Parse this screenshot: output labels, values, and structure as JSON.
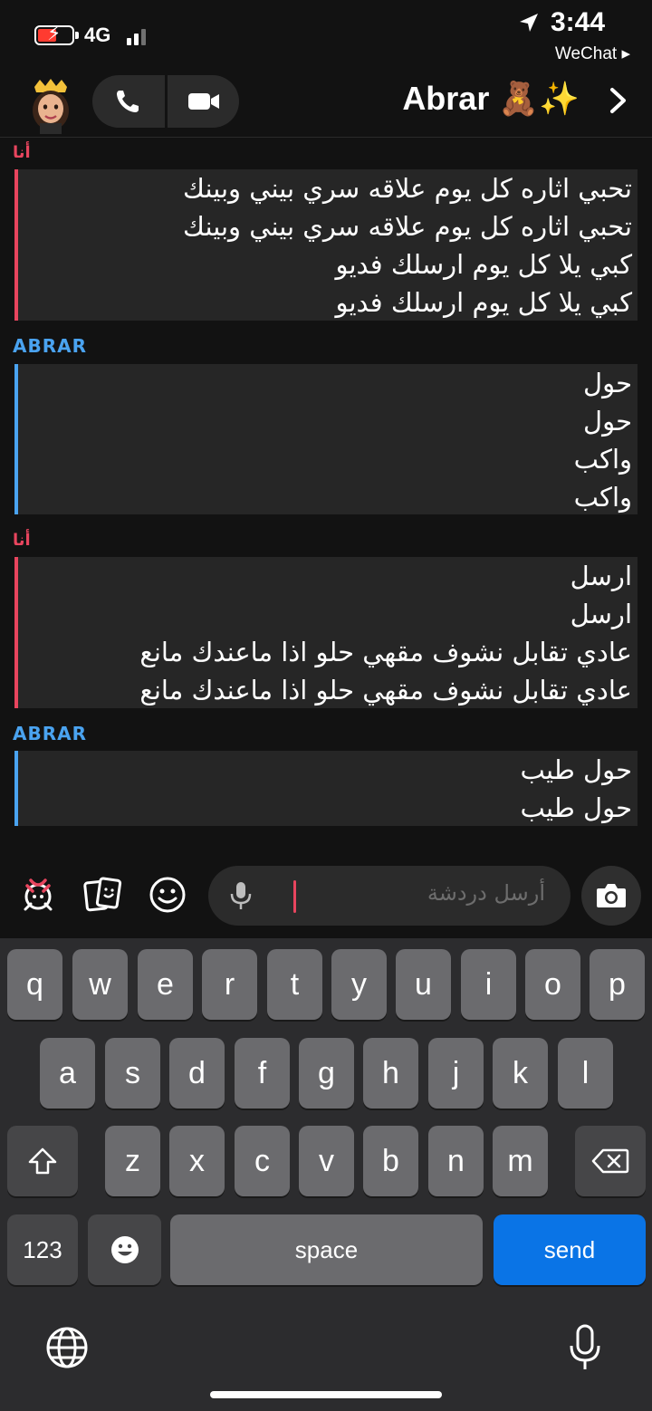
{
  "status_bar": {
    "network": "4G",
    "time": "3:44",
    "back_app": "WeChat ▸"
  },
  "header": {
    "contact_name": "Abrar 🧸✨"
  },
  "messages": [
    {
      "sender": "أنا",
      "from_me": true,
      "lines": [
        "تحبي اثاره كل يوم علاقه سري بيني وبينك",
        "تحبي اثاره كل يوم علاقه سري بيني وبينك",
        "كبي يلا كل يوم ارسلك فديو",
        "كبي يلا كل يوم ارسلك فديو"
      ]
    },
    {
      "sender": "ABRAR",
      "from_me": false,
      "lines": [
        "حول",
        "حول",
        "واكب",
        "واكب"
      ]
    },
    {
      "sender": "أنا",
      "from_me": true,
      "lines": [
        "ارسل",
        "ارسل",
        "عادي تقابل نشوف مقهي حلو اذا ماعندك مانع",
        "عادي تقابل نشوف مقهي حلو اذا ماعندك مانع"
      ]
    },
    {
      "sender": "ABRAR",
      "from_me": false,
      "lines": [
        "حول طيب",
        "حول طيب"
      ]
    }
  ],
  "composer": {
    "placeholder": "أرسل دردشة"
  },
  "keyboard": {
    "row1": [
      "q",
      "w",
      "e",
      "r",
      "t",
      "y",
      "u",
      "i",
      "o",
      "p"
    ],
    "row2": [
      "a",
      "s",
      "d",
      "f",
      "g",
      "h",
      "j",
      "k",
      "l"
    ],
    "row3": [
      "z",
      "x",
      "c",
      "v",
      "b",
      "n",
      "m"
    ],
    "numbers_label": "123",
    "space_label": "space",
    "send_label": "send"
  },
  "colors": {
    "me_accent": "#e8455e",
    "them_accent": "#4aa3f0",
    "send_key": "#0a74e6"
  }
}
